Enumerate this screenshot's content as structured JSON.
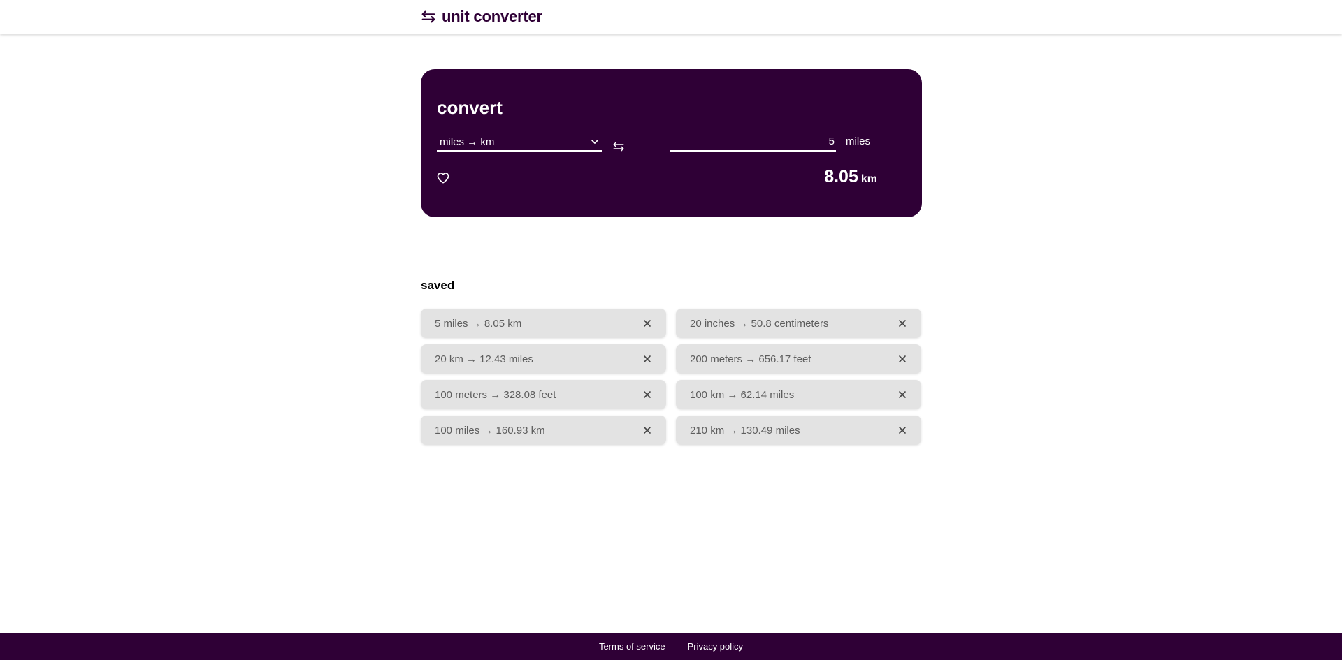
{
  "header": {
    "title": "unit converter",
    "logo_icon": "swap-arrows-icon"
  },
  "converter": {
    "title": "convert",
    "conversion_select": "miles → km",
    "amount": "5",
    "from_unit": "miles",
    "result_value": "8.05",
    "result_unit": "km",
    "swap_icon": "swap-arrows-icon",
    "save_icon": "heart-icon"
  },
  "saved": {
    "title": "saved",
    "items": [
      "5 miles → 8.05 km",
      "20 inches → 50.8 centimeters",
      "20 km → 12.43 miles",
      "200 meters → 656.17 feet",
      "100 meters → 328.08 feet",
      "100 km → 62.14 miles",
      "100 miles → 160.93 km",
      "210 km → 130.49 miles"
    ],
    "remove_icon": "close-icon"
  },
  "footer": {
    "terms": "Terms of service",
    "privacy": "Privacy policy"
  },
  "colors": {
    "brand": "#2f0036",
    "saved_item_bg": "#e3e3e3",
    "saved_item_text": "#5e5e5e"
  }
}
